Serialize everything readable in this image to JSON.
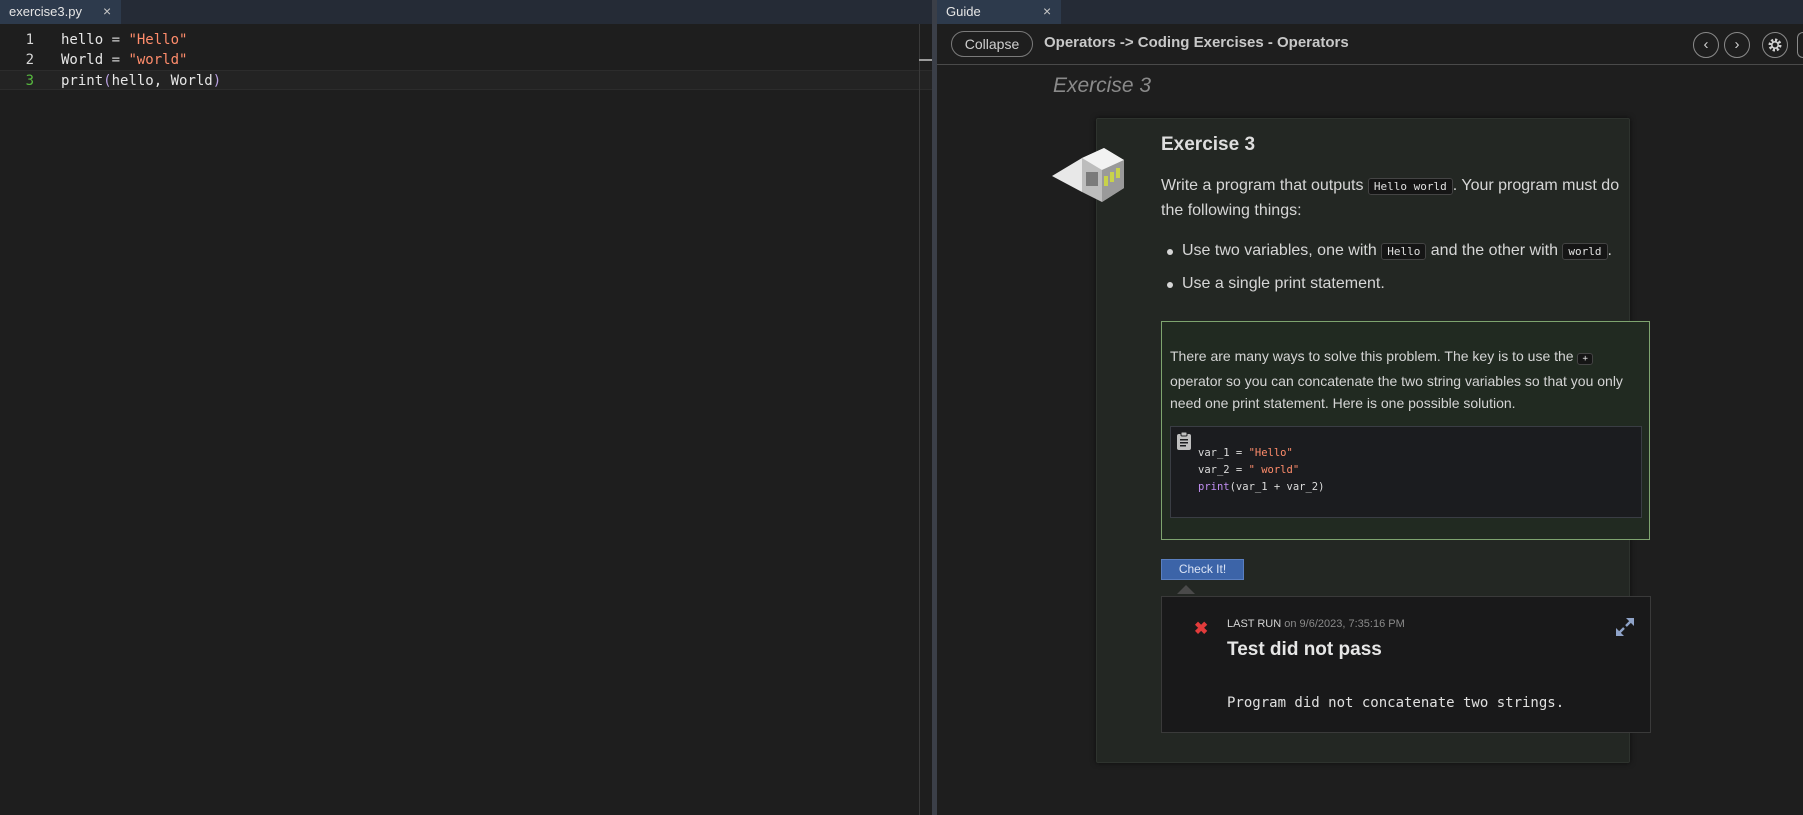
{
  "editor": {
    "tab_label": "exercise3.py",
    "close_glyph": "×",
    "lines": [
      {
        "num": "1",
        "parts": [
          "hello",
          " = ",
          "\"Hello\""
        ]
      },
      {
        "num": "2",
        "parts": [
          "World",
          " = ",
          "\"world\""
        ]
      },
      {
        "num": "3",
        "parts": [
          "print",
          "(",
          "hello, World",
          ")"
        ]
      }
    ]
  },
  "guide": {
    "tab_label": "Guide",
    "close_glyph": "×",
    "collapse_label": "Collapse",
    "breadcrumb": "Operators -> Coding Exercises - Operators",
    "prev_glyph": "‹",
    "next_glyph": "›",
    "icons": {
      "prev": "chevron-left-icon",
      "next": "chevron-right-icon",
      "settings": "gear-icon"
    },
    "section_heading": "Exercise 3",
    "exercise": {
      "title": "Exercise 3",
      "para_before": "Write a program that outputs ",
      "para_code": "Hello world",
      "para_after": ". Your program must do the following things:",
      "bullet1_before": "Use two variables, one with ",
      "bullet1_code1": "Hello",
      "bullet1_mid": " and the other with ",
      "bullet1_code2": "world",
      "bullet1_after": ".",
      "bullet2": "Use a single print statement."
    },
    "hint": {
      "text_before": "There are many ways to solve this problem. The key is to use the ",
      "text_code": "+",
      "text_after": " operator so you can concatenate the two string variables so that you only need one print statement. Here is one possible solution.",
      "code": {
        "l1_var": "var_1 = ",
        "l1_str": "\"Hello\"",
        "l2_var": "var_2 = ",
        "l2_str": "\" world\"",
        "l3_kw": "print",
        "l3_rest": "(var_1 + var_2)"
      }
    },
    "check_label": "Check It!",
    "result": {
      "status": "fail",
      "last_run_label": "LAST RUN",
      "last_run_when": "on 9/6/2023, 7:35:16 PM",
      "title": "Test did not pass",
      "message": "Program did not concatenate two strings."
    }
  },
  "colors": {
    "string": "#ff8c6b",
    "keyword": "#c08ef0",
    "fail": "#e23b3b",
    "check_button": "#3c64a8",
    "hint_border": "#7ea46f"
  }
}
